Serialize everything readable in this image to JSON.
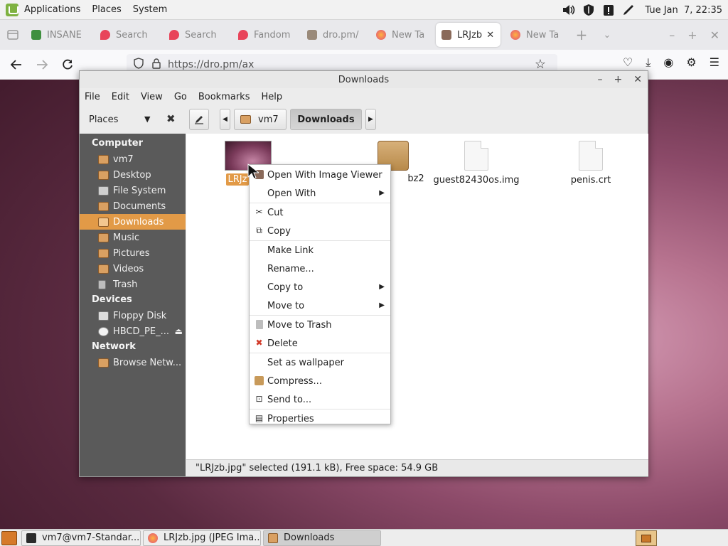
{
  "system_panel": {
    "menus": [
      "Applications",
      "Places",
      "System"
    ],
    "clock": "Tue Jan  7, 22:35",
    "tray_icons": [
      "volume-icon",
      "shield-icon",
      "clipboard-alert-icon",
      "pen-icon"
    ]
  },
  "browser": {
    "tabs": [
      {
        "label": "INSANE",
        "icon": "game-icon"
      },
      {
        "label": "Search",
        "icon": "fandom-icon"
      },
      {
        "label": "Search",
        "icon": "fandom-icon"
      },
      {
        "label": "Fandom",
        "icon": "fandom-icon"
      },
      {
        "label": "dro.pm/",
        "icon": "image-icon"
      },
      {
        "label": "New Ta",
        "icon": "firefox-icon"
      },
      {
        "label": "LRJzb",
        "icon": "image-icon",
        "active": true
      },
      {
        "label": "New Ta",
        "icon": "firefox-icon"
      }
    ],
    "url": "https://dro.pm/ax"
  },
  "nemo": {
    "title": "Downloads",
    "menu": [
      "File",
      "Edit",
      "View",
      "Go",
      "Bookmarks",
      "Help"
    ],
    "places_label": "Places",
    "path": [
      "vm7",
      "Downloads"
    ],
    "sidebar": [
      {
        "type": "header",
        "label": "Computer"
      },
      {
        "type": "item",
        "label": "vm7",
        "icon": "home-folder-icon"
      },
      {
        "type": "item",
        "label": "Desktop",
        "icon": "desktop-folder-icon"
      },
      {
        "type": "item",
        "label": "File System",
        "icon": "drive-icon"
      },
      {
        "type": "item",
        "label": "Documents",
        "icon": "folder-icon"
      },
      {
        "type": "item",
        "label": "Downloads",
        "icon": "downloads-folder-icon",
        "selected": true
      },
      {
        "type": "item",
        "label": "Music",
        "icon": "music-folder-icon"
      },
      {
        "type": "item",
        "label": "Pictures",
        "icon": "pictures-folder-icon"
      },
      {
        "type": "item",
        "label": "Videos",
        "icon": "videos-folder-icon"
      },
      {
        "type": "item",
        "label": "Trash",
        "icon": "trash-icon"
      },
      {
        "type": "header",
        "label": "Devices"
      },
      {
        "type": "item",
        "label": "Floppy Disk",
        "icon": "floppy-icon"
      },
      {
        "type": "item",
        "label": "HBCD_PE_...",
        "icon": "cdrom-icon",
        "eject": true
      },
      {
        "type": "header",
        "label": "Network"
      },
      {
        "type": "item",
        "label": "Browse Netw...",
        "icon": "network-icon"
      }
    ],
    "files": [
      {
        "name": "LRJz",
        "kind": "image",
        "selected": true
      },
      {
        "name": "bz2",
        "kind": "archive"
      },
      {
        "name": "guest82430os.img",
        "kind": "document"
      },
      {
        "name": "penis.crt",
        "kind": "document"
      }
    ],
    "status": "\"LRJzb.jpg\" selected (191.1 kB), Free space: 54.9 GB"
  },
  "context_menu": {
    "groups": [
      [
        {
          "label": "Open With Image Viewer",
          "icon": "image-viewer-icon"
        },
        {
          "label": "Open With",
          "submenu": true
        }
      ],
      [
        {
          "label": "Cut",
          "icon": "scissors-icon"
        },
        {
          "label": "Copy",
          "icon": "copy-icon"
        }
      ],
      [
        {
          "label": "Make Link"
        },
        {
          "label": "Rename..."
        },
        {
          "label": "Copy to",
          "submenu": true
        },
        {
          "label": "Move to",
          "submenu": true
        }
      ],
      [
        {
          "label": "Move to Trash",
          "icon": "trash-icon"
        },
        {
          "label": "Delete",
          "icon": "delete-x-icon"
        }
      ],
      [
        {
          "label": "Set as wallpaper"
        },
        {
          "label": "Compress...",
          "icon": "archive-icon"
        },
        {
          "label": "Send to...",
          "icon": "send-icon"
        }
      ],
      [
        {
          "label": "Properties",
          "icon": "properties-icon"
        }
      ]
    ]
  },
  "taskbar": {
    "items": [
      {
        "label": "vm7@vm7-Standar...",
        "icon": "terminal-icon"
      },
      {
        "label": "LRJzb.jpg (JPEG Ima...",
        "icon": "firefox-icon"
      },
      {
        "label": "Downloads",
        "icon": "folder-icon",
        "active": true
      }
    ]
  },
  "colors": {
    "selection": "#e29a47",
    "sidebar_bg": "#5a5a5a",
    "delete_icon": "#d23b2a"
  }
}
